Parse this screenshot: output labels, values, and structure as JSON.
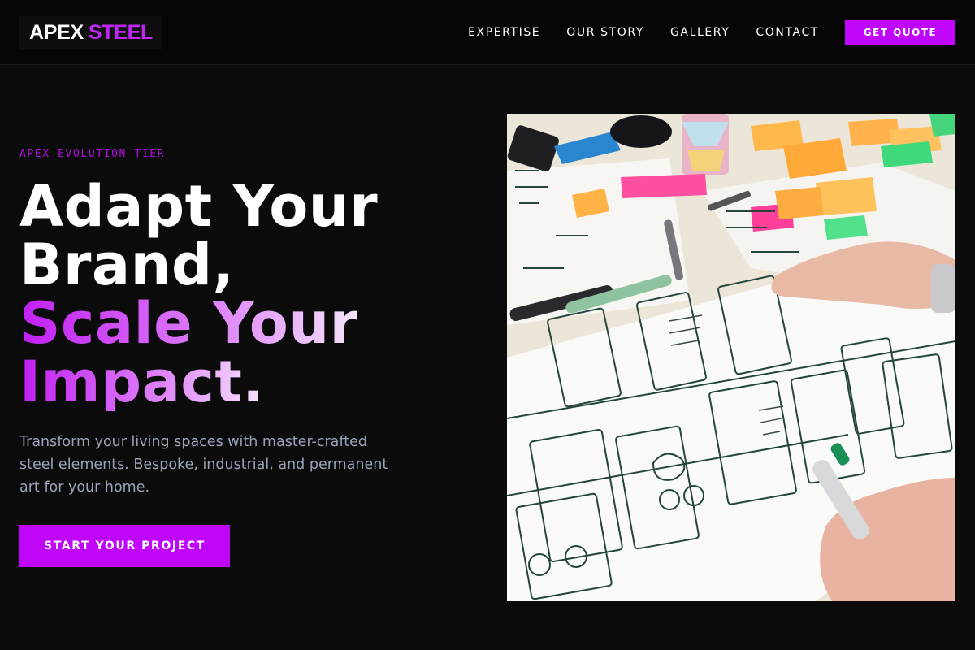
{
  "header": {
    "logo": {
      "word1": "APEX",
      "word2": "STEEL"
    },
    "nav": [
      {
        "label": "EXPERTISE"
      },
      {
        "label": "OUR STORY"
      },
      {
        "label": "GALLERY"
      },
      {
        "label": "CONTACT"
      }
    ],
    "quote_button": "GET QUOTE"
  },
  "hero": {
    "eyebrow": "APEX EVOLUTION TIER",
    "headline": {
      "line1": "Adapt Your",
      "line2": "Brand,",
      "line3": "Scale Your",
      "line4": "Impact."
    },
    "lead": "Transform your living spaces with master-crafted steel elements. Bespoke, industrial, and permanent art for your home.",
    "cta": "START YOUR PROJECT",
    "image": {
      "subject": "hand-drawn-wireframe-sketches-photo"
    }
  },
  "colors": {
    "accent": "#c005fb",
    "accent_text": "#b00de0",
    "background": "#0b0b0c",
    "header_bg": "#050505",
    "lead_text": "#9aa3b6"
  }
}
